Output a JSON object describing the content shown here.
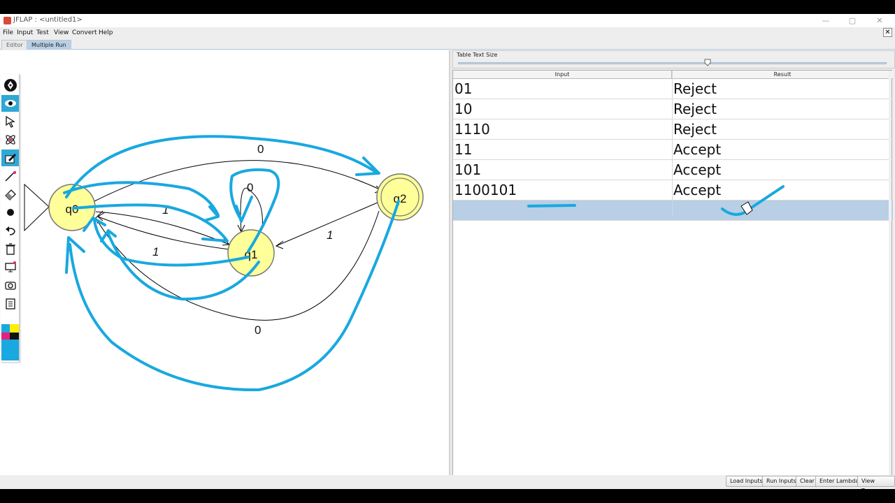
{
  "window": {
    "title": "JFLAP : <untitled1>",
    "controls": {
      "minimize": "—",
      "maximize": "▢",
      "close": "✕"
    }
  },
  "menu": [
    "File",
    "Input",
    "Test",
    "View",
    "Convert",
    "Help"
  ],
  "tabs": [
    {
      "label": "Editor",
      "active": false
    },
    {
      "label": "Multiple Run",
      "active": true
    }
  ],
  "toolbar": {
    "tools": [
      {
        "name": "attribute-editor",
        "icon": "pen-nib-icon",
        "selected": false
      },
      {
        "name": "view",
        "icon": "eye-icon",
        "selected": true
      },
      {
        "name": "select",
        "icon": "arrow-cursor-icon",
        "selected": false
      },
      {
        "name": "state-creator",
        "icon": "atom-icon",
        "selected": false
      },
      {
        "name": "transition-creator",
        "icon": "pencil-box-icon",
        "selected": true
      },
      {
        "name": "line",
        "icon": "line-pen-icon",
        "selected": false
      },
      {
        "name": "eraser",
        "icon": "eraser-icon",
        "selected": false
      },
      {
        "name": "dot",
        "icon": "dot-icon",
        "selected": false
      },
      {
        "name": "undo",
        "icon": "undo-icon",
        "selected": false
      },
      {
        "name": "trash",
        "icon": "trash-icon",
        "selected": false
      },
      {
        "name": "screen",
        "icon": "screen-icon",
        "selected": false
      },
      {
        "name": "camera",
        "icon": "camera-icon",
        "selected": false
      },
      {
        "name": "clipboard",
        "icon": "clipboard-icon",
        "selected": false
      }
    ],
    "swatch_colors": [
      "#19a8e0",
      "#ffee00",
      "#e8207a",
      "#111111",
      "#19a8e0"
    ]
  },
  "automaton": {
    "states": [
      "q0",
      "q1",
      "q2"
    ],
    "initial": "q0",
    "final": [
      "q2"
    ],
    "transitions": [
      {
        "from": "q0",
        "to": "q2",
        "label": "0"
      },
      {
        "from": "q1",
        "to": "q1",
        "label": "0"
      },
      {
        "from": "q0",
        "to": "q1",
        "label": "1"
      },
      {
        "from": "q1",
        "to": "q0",
        "label": "1"
      },
      {
        "from": "q2",
        "to": "q1",
        "label": "1"
      },
      {
        "from": "q2",
        "to": "q0",
        "label": "0"
      }
    ],
    "colors": {
      "state_fill": "#ffff99",
      "state_stroke": "#777",
      "ink": "#19a8e0"
    }
  },
  "multirun": {
    "text_size_label": "Table Text Size",
    "text_size_level": 0.58,
    "columns": [
      "Input",
      "Result"
    ],
    "rows": [
      {
        "input": "01",
        "result": "Reject"
      },
      {
        "input": "10",
        "result": "Reject"
      },
      {
        "input": "1110",
        "result": "Reject"
      },
      {
        "input": "11",
        "result": "Accept"
      },
      {
        "input": "101",
        "result": "Accept"
      },
      {
        "input": "1100101",
        "result": "Accept"
      },
      {
        "input": "",
        "result": ""
      }
    ]
  },
  "buttons": [
    "Load Inputs",
    "Run Inputs",
    "Clear",
    "Enter Lambda",
    "View Trace"
  ]
}
